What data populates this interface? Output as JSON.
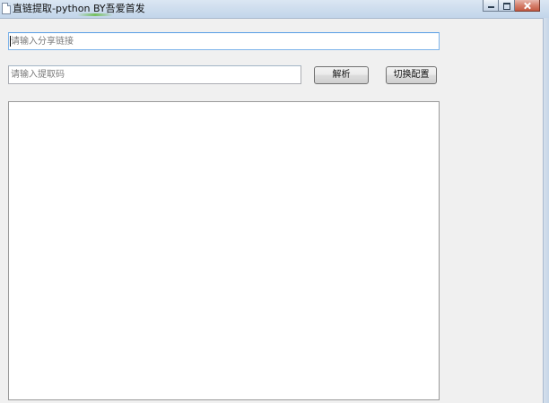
{
  "window": {
    "title": "直链提取-python BY吾爱首发"
  },
  "share_link": {
    "value": "",
    "placeholder": "请输入分享链接"
  },
  "extract_code": {
    "value": "",
    "placeholder": "请输入提取码"
  },
  "buttons": {
    "parse_label": "解析",
    "config_label": "切换配置"
  },
  "output": {
    "value": ""
  },
  "icons": {
    "app": "document-icon",
    "minimize": "minimize-icon",
    "maximize": "maximize-icon",
    "close": "close-icon"
  }
}
